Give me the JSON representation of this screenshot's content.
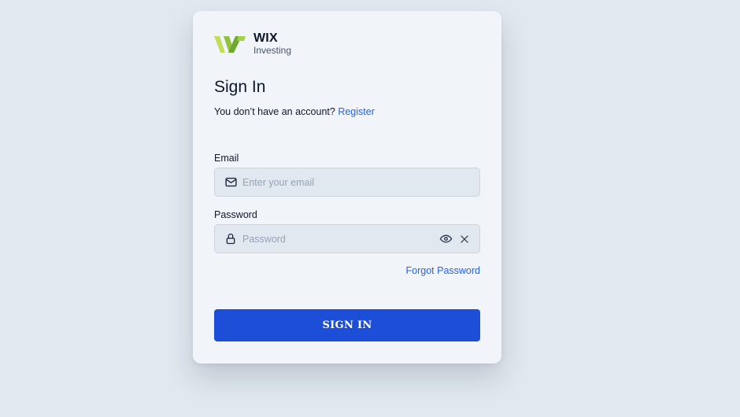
{
  "brand": {
    "name": "WIX",
    "sub": "Investing",
    "colors": {
      "mark_light": "#c2dd5a",
      "mark_dark": "#6fa82e"
    }
  },
  "form": {
    "title": "Sign In",
    "register_prompt": "You don’t have an account?",
    "register_link": "Register",
    "email_label": "Email",
    "email_placeholder": "Enter your email",
    "email_value": "",
    "password_label": "Password",
    "password_placeholder": "Password",
    "password_value": "",
    "forgot_link": "Forgot Password",
    "submit_label": "SIGN IN"
  },
  "icons": {
    "email": "mail-icon",
    "password": "lock-icon",
    "show_password": "eye-icon",
    "clear": "close-icon"
  },
  "theme": {
    "accent": "#1d4ed8",
    "link": "#2563eb",
    "page_bg": "#e2e8f0",
    "card_bg": "#f1f5f9"
  }
}
